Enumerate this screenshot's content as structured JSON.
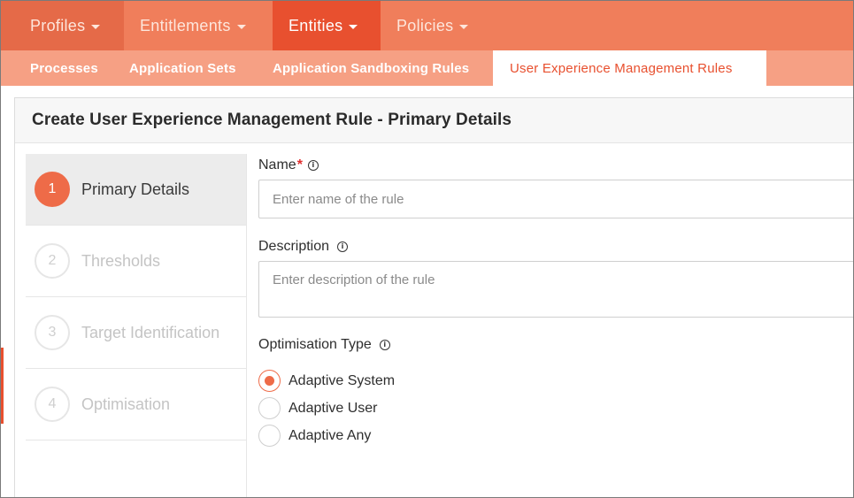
{
  "topnav": {
    "items": [
      {
        "label": "Profiles"
      },
      {
        "label": "Entitlements"
      },
      {
        "label": "Entities"
      },
      {
        "label": "Policies"
      }
    ]
  },
  "subnav": {
    "items": [
      {
        "label": "Processes"
      },
      {
        "label": "Application Sets"
      },
      {
        "label": "Application Sandboxing Rules"
      },
      {
        "label": "User Experience Management Rules"
      }
    ]
  },
  "panel": {
    "title": "Create User Experience Management Rule - Primary Details"
  },
  "steps": [
    {
      "number": "1",
      "label": "Primary Details",
      "active": true
    },
    {
      "number": "2",
      "label": "Thresholds",
      "active": false
    },
    {
      "number": "3",
      "label": "Target Identification",
      "active": false
    },
    {
      "number": "4",
      "label": "Optimisation",
      "active": false
    }
  ],
  "form": {
    "name_label": "Name",
    "required_mark": "*",
    "name_placeholder": "Enter name of the rule",
    "description_label": "Description",
    "description_placeholder": "Enter description of the rule",
    "optimisation_label": "Optimisation Type",
    "info_glyph": "i",
    "options": [
      {
        "label": "Adaptive System",
        "selected": true
      },
      {
        "label": "Adaptive User",
        "selected": false
      },
      {
        "label": "Adaptive Any",
        "selected": false
      }
    ]
  },
  "colors": {
    "accent": "#e8502f",
    "nav_bg": "#f07e5b",
    "subnav_bg": "#f6a084"
  }
}
